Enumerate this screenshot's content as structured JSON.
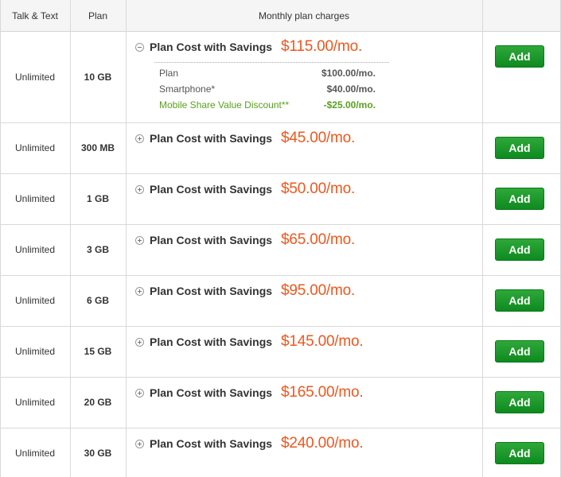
{
  "headers": {
    "talk": "Talk & Text",
    "plan": "Plan",
    "charges": "Monthly plan charges"
  },
  "cost_label": "Plan Cost with Savings",
  "add_label": "Add",
  "rows": [
    {
      "talk": "Unlimited",
      "plan": "10 GB",
      "price": "$115.00/mo."
    },
    {
      "talk": "Unlimited",
      "plan": "300 MB",
      "price": "$45.00/mo."
    },
    {
      "talk": "Unlimited",
      "plan": "1 GB",
      "price": "$50.00/mo."
    },
    {
      "talk": "Unlimited",
      "plan": "3 GB",
      "price": "$65.00/mo."
    },
    {
      "talk": "Unlimited",
      "plan": "6 GB",
      "price": "$95.00/mo."
    },
    {
      "talk": "Unlimited",
      "plan": "15 GB",
      "price": "$145.00/mo."
    },
    {
      "talk": "Unlimited",
      "plan": "20 GB",
      "price": "$165.00/mo."
    },
    {
      "talk": "Unlimited",
      "plan": "30 GB",
      "price": "$240.00/mo."
    }
  ],
  "breakdown": [
    {
      "name": "Plan",
      "value": "$100.00/mo."
    },
    {
      "name": "Smartphone*",
      "value": "$40.00/mo."
    },
    {
      "name": "Mobile Share Value Discount**",
      "value": "-$25.00/mo."
    }
  ],
  "colors": {
    "price": "#f2561d",
    "add_button": "#179a2a",
    "discount": "#5aa01e"
  }
}
